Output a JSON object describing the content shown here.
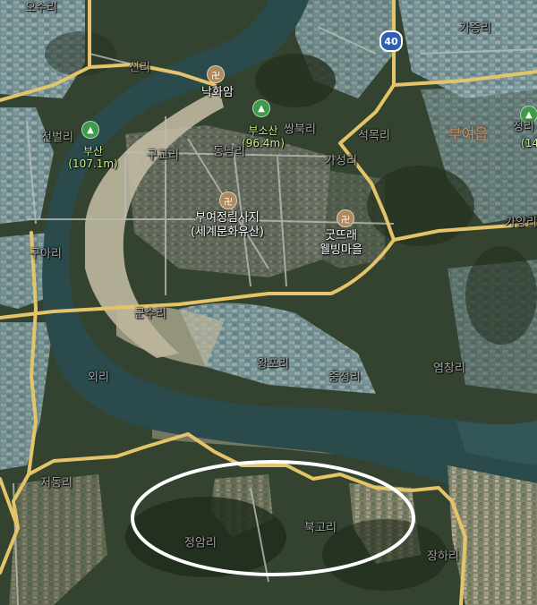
{
  "map": {
    "towns": [
      {
        "id": "buyeo-eup",
        "label": "부여읍"
      },
      {
        "id": "jangri-partial",
        "label": "정리"
      }
    ],
    "places": {
      "o_suri": "오수리",
      "sinri": "신리",
      "jeonbeolri": "전벌리",
      "guaeri": "구아리",
      "gugyori": "구교리",
      "dongnamri": "동남리",
      "gunsuri": "군수리",
      "oeri": "외리",
      "jeodongri": "저동리",
      "jeongamri": "정암리",
      "bukgori": "북고리",
      "janghari": "장하리",
      "ssangbukri": "쌍북리",
      "wangpori": "왕포리",
      "junggeongri": "중정리",
      "yeomchangri": "염창리",
      "seongmokri": "석목리",
      "gajeungri": "가증리",
      "gaseongri": "가성리",
      "gayangri": "가양리"
    },
    "pois": {
      "nakhwaam": "낙화암",
      "jeongnimsaji_line1": "부여정림사지",
      "jeongnimsaji_line2": "(세계문화유산)",
      "gutdurae_line1": "굿뜨래",
      "gutdurae_line2": "웰빙마을"
    },
    "mountains": {
      "busan_name": "부산",
      "busan_elev": "(107.1m)",
      "busosan_name": "부소산",
      "busosan_elev": "(96.4m)",
      "edge_elev": "(14"
    },
    "route_number": "40",
    "icons": {
      "temple": "temple-pin-icon",
      "mountain": "mountain-pin-icon",
      "route": "route-shield-icon"
    },
    "colors": {
      "road": "#e4c46a",
      "river": "#2a4a4c",
      "highlight_ellipse": "#ffffff",
      "town_label": "#d98a55",
      "mountain_label": "#c9f28a"
    }
  }
}
